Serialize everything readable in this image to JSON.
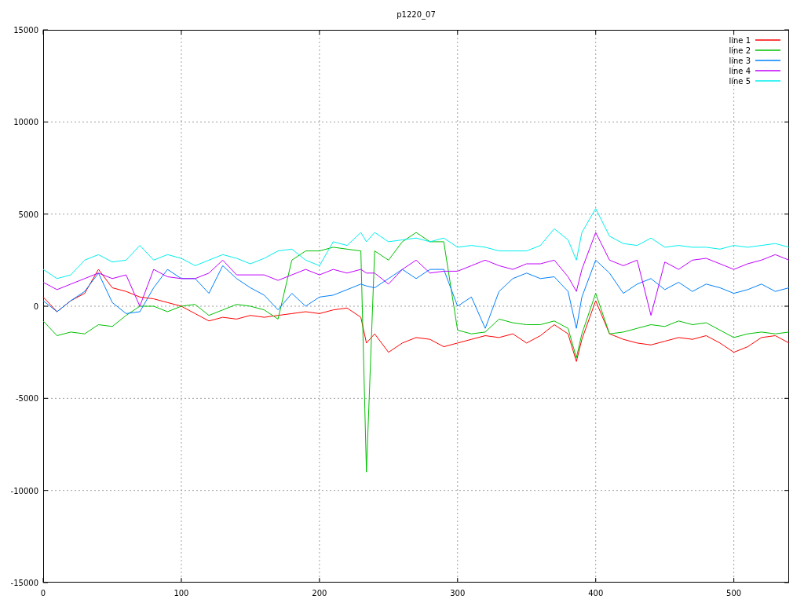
{
  "plot": {
    "chart_data": {
      "type": "line",
      "title": "p1220_07",
      "x": [
        0,
        10,
        20,
        30,
        40,
        50,
        60,
        70,
        80,
        90,
        100,
        110,
        120,
        130,
        140,
        150,
        160,
        170,
        180,
        190,
        200,
        210,
        220,
        230,
        234,
        240,
        250,
        260,
        270,
        280,
        290,
        300,
        310,
        320,
        330,
        340,
        350,
        360,
        370,
        380,
        386,
        390,
        400,
        410,
        420,
        430,
        440,
        450,
        460,
        470,
        480,
        490,
        500,
        510,
        520,
        530,
        540
      ],
      "series": [
        {
          "name": "line 1",
          "color": "#ff0000",
          "values": [
            500,
            -300,
            300,
            700,
            2000,
            1000,
            800,
            500,
            400,
            200,
            0,
            -400,
            -800,
            -600,
            -700,
            -500,
            -600,
            -500,
            -400,
            -300,
            -400,
            -200,
            -100,
            -600,
            -2000,
            -1500,
            -2500,
            -2000,
            -1700,
            -1800,
            -2200,
            -2000,
            -1800,
            -1600,
            -1700,
            -1500,
            -2000,
            -1600,
            -1000,
            -1500,
            -3000,
            -1800,
            300,
            -1500,
            -1800,
            -2000,
            -2100,
            -1900,
            -1700,
            -1800,
            -1600,
            -2000,
            -2500,
            -2200,
            -1700,
            -1600,
            -2000
          ]
        },
        {
          "name": "line 2",
          "color": "#00c000",
          "values": [
            -800,
            -1600,
            -1400,
            -1500,
            -1000,
            -1100,
            -500,
            0,
            0,
            -300,
            0,
            100,
            -500,
            -200,
            100,
            0,
            -200,
            -700,
            2500,
            3000,
            3000,
            3200,
            3100,
            3000,
            -9000,
            3000,
            2500,
            3500,
            4000,
            3500,
            3500,
            -1300,
            -1500,
            -1400,
            -700,
            -900,
            -1000,
            -1000,
            -800,
            -1200,
            -2800,
            -1500,
            700,
            -1500,
            -1400,
            -1200,
            -1000,
            -1100,
            -800,
            -1000,
            -900,
            -1300,
            -1700,
            -1500,
            -1400,
            -1500,
            -1400
          ]
        },
        {
          "name": "line 3",
          "color": "#0080ff",
          "values": [
            300,
            -300,
            300,
            800,
            1800,
            200,
            -400,
            -300,
            1000,
            2000,
            1500,
            1500,
            700,
            2200,
            1500,
            1000,
            600,
            -200,
            700,
            0,
            500,
            600,
            900,
            1200,
            1100,
            1000,
            1500,
            2000,
            1500,
            2000,
            2000,
            0,
            500,
            -1200,
            800,
            1500,
            1800,
            1500,
            1600,
            800,
            -1200,
            500,
            2500,
            1800,
            700,
            1200,
            1500,
            900,
            1300,
            800,
            1200,
            1000,
            700,
            900,
            1200,
            800,
            1000
          ]
        },
        {
          "name": "line 4",
          "color": "#c000ff",
          "values": [
            1300,
            900,
            1200,
            1500,
            1800,
            1500,
            1700,
            0,
            2000,
            1600,
            1500,
            1500,
            1800,
            2500,
            1700,
            1700,
            1700,
            1400,
            1700,
            2000,
            1700,
            2000,
            1800,
            2000,
            1800,
            1800,
            1200,
            2000,
            2500,
            1800,
            1900,
            1900,
            2200,
            2500,
            2200,
            2000,
            2300,
            2300,
            2500,
            1600,
            800,
            2000,
            4000,
            2500,
            2200,
            2500,
            -500,
            2400,
            2000,
            2500,
            2600,
            2300,
            2000,
            2300,
            2500,
            2800,
            2500
          ]
        },
        {
          "name": "line 5",
          "color": "#00eeee",
          "values": [
            2000,
            1500,
            1700,
            2500,
            2800,
            2400,
            2500,
            3300,
            2500,
            2800,
            2600,
            2200,
            2500,
            2800,
            2600,
            2300,
            2600,
            3000,
            3100,
            2500,
            2200,
            3500,
            3300,
            4000,
            3500,
            4000,
            3500,
            3600,
            3700,
            3500,
            3700,
            3200,
            3300,
            3200,
            3000,
            3000,
            3000,
            3300,
            4200,
            3600,
            2500,
            4000,
            5300,
            3800,
            3400,
            3300,
            3700,
            3200,
            3300,
            3200,
            3200,
            3100,
            3300,
            3200,
            3300,
            3400,
            3200
          ]
        }
      ],
      "xlim": [
        0,
        540
      ],
      "ylim": [
        -15000,
        15000
      ],
      "xticks": [
        0,
        100,
        200,
        300,
        400,
        500
      ],
      "yticks": [
        -15000,
        -10000,
        -5000,
        0,
        5000,
        10000,
        15000
      ],
      "grid": true,
      "legend": true
    }
  }
}
